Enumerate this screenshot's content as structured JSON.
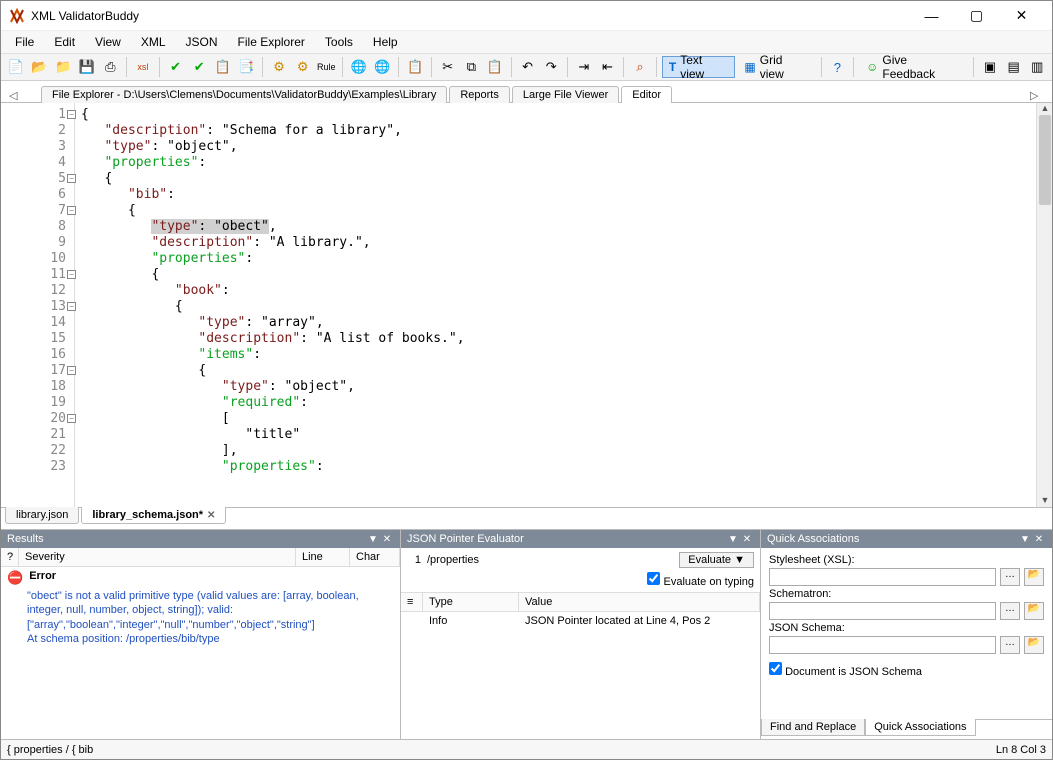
{
  "window": {
    "title": "XML ValidatorBuddy"
  },
  "menus": [
    "File",
    "Edit",
    "View",
    "XML",
    "JSON",
    "File Explorer",
    "Tools",
    "Help"
  ],
  "toolbar": {
    "text_view": "Text view",
    "grid_view": "Grid view",
    "feedback": "Give Feedback"
  },
  "top_tabs": {
    "file_explorer": "File Explorer - D:\\Users\\Clemens\\Documents\\ValidatorBuddy\\Examples\\Library",
    "reports": "Reports",
    "large_file_viewer": "Large File Viewer",
    "editor": "Editor"
  },
  "code": {
    "lines": [
      {
        "n": 1,
        "fold": true,
        "html": "{"
      },
      {
        "n": 2,
        "html": "   <span class='k'>\"description\"</span>: <span class='s'>\"Schema for a library\"</span>,"
      },
      {
        "n": 3,
        "html": "   <span class='k'>\"type\"</span>: <span class='s'>\"object\"</span>,"
      },
      {
        "n": 4,
        "html": "   <span class='kw'>\"properties\"</span>:"
      },
      {
        "n": 5,
        "fold": true,
        "html": "   {"
      },
      {
        "n": 6,
        "html": "      <span class='k'>\"bib\"</span>:"
      },
      {
        "n": 7,
        "fold": true,
        "html": "      {"
      },
      {
        "n": 8,
        "html": "         <span class='highlight'><span class='k'>\"type\"</span>: <span class='s'>\"obect\"</span></span>,"
      },
      {
        "n": 9,
        "html": "         <span class='k'>\"description\"</span>: <span class='s'>\"A library.\"</span>,"
      },
      {
        "n": 10,
        "html": "         <span class='kw'>\"properties\"</span>:"
      },
      {
        "n": 11,
        "fold": true,
        "html": "         {"
      },
      {
        "n": 12,
        "html": "            <span class='k'>\"book\"</span>:"
      },
      {
        "n": 13,
        "fold": true,
        "html": "            {"
      },
      {
        "n": 14,
        "html": "               <span class='k'>\"type\"</span>: <span class='s'>\"array\"</span>,"
      },
      {
        "n": 15,
        "html": "               <span class='k'>\"description\"</span>: <span class='s'>\"A list of books.\"</span>,"
      },
      {
        "n": 16,
        "html": "               <span class='kw'>\"items\"</span>:"
      },
      {
        "n": 17,
        "fold": true,
        "html": "               {"
      },
      {
        "n": 18,
        "html": "                  <span class='k'>\"type\"</span>: <span class='s'>\"object\"</span>,"
      },
      {
        "n": 19,
        "html": "                  <span class='kw'>\"required\"</span>:"
      },
      {
        "n": 20,
        "fold": true,
        "html": "                  ["
      },
      {
        "n": 21,
        "html": "                     <span class='s'>\"title\"</span>"
      },
      {
        "n": 22,
        "html": "                  ],"
      },
      {
        "n": 23,
        "html": "                  <span class='kw'>\"properties\"</span>:"
      }
    ]
  },
  "doc_tabs": [
    {
      "label": "library.json",
      "active": false,
      "dirty": false
    },
    {
      "label": "library_schema.json*",
      "active": true,
      "dirty": true
    }
  ],
  "results": {
    "title": "Results",
    "cols": {
      "severity": "Severity",
      "line": "Line",
      "char": "Char"
    },
    "error_label": "Error",
    "detail1": "\"obect\" is not a valid primitive type (valid values are: [array, boolean, integer, null, number, object, string]); valid:",
    "detail2": "[\"array\",\"boolean\",\"integer\",\"null\",\"number\",\"object\",\"string\"]",
    "detail3": "At schema position: /properties/bib/type"
  },
  "json_pointer": {
    "title": "JSON Pointer Evaluator",
    "row_num": "1",
    "path": "/properties",
    "evaluate": "Evaluate",
    "eval_on_typing": "Evaluate on typing",
    "col_type": "Type",
    "col_value": "Value",
    "info_label": "Info",
    "info_value": "JSON Pointer located at Line 4, Pos 2"
  },
  "quick_assoc": {
    "title": "Quick Associations",
    "stylesheet": "Stylesheet (XSL):",
    "schematron": "Schematron:",
    "json_schema": "JSON Schema:",
    "doc_is_schema": "Document is JSON Schema",
    "tab_find": "Find and Replace",
    "tab_qa": "Quick Associations"
  },
  "status": {
    "path": "{ properties / { bib",
    "pos": "Ln 8   Col 3"
  }
}
